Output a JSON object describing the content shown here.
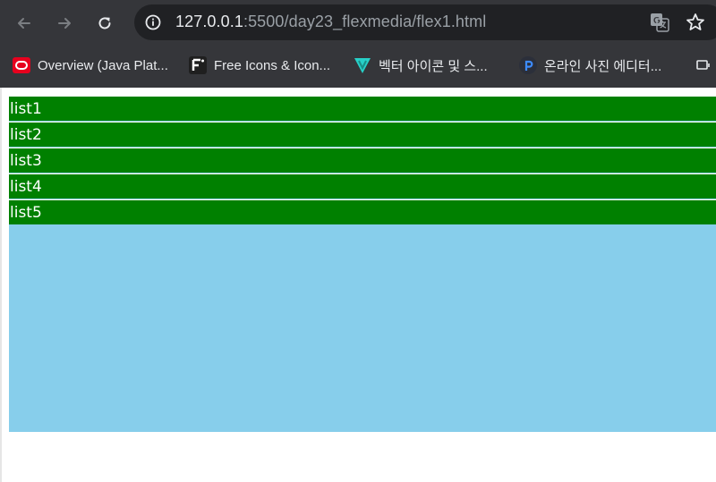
{
  "browser": {
    "url_host": "127.0.0.1",
    "url_rest": ":5500/day23_flexmedia/flex1.html",
    "icons": {
      "back": "arrow-left-icon",
      "forward": "arrow-right-icon",
      "reload": "reload-icon",
      "info": "info-icon",
      "translate": "translate-icon",
      "bookmark": "star-icon"
    }
  },
  "bookmarks": [
    {
      "label": "Overview (Java Plat...",
      "icon": "oracle-icon",
      "color": "#e7001e"
    },
    {
      "label": "Free Icons & Icon...",
      "icon": "flaticon-icon",
      "color": "#1f1f1f"
    },
    {
      "label": "벡터 아이콘 및 스...",
      "icon": "vector-icon",
      "color": "#27d0c8"
    },
    {
      "label": "온라인 사진 에디터...",
      "icon": "pixlr-icon",
      "color": "#3d8bff"
    }
  ],
  "page": {
    "list_items": [
      "list1",
      "list2",
      "list3",
      "list4",
      "list5"
    ],
    "colors": {
      "item_bg": "#008000",
      "container_bg": "#87ceeb",
      "item_text": "#ffffff"
    }
  }
}
